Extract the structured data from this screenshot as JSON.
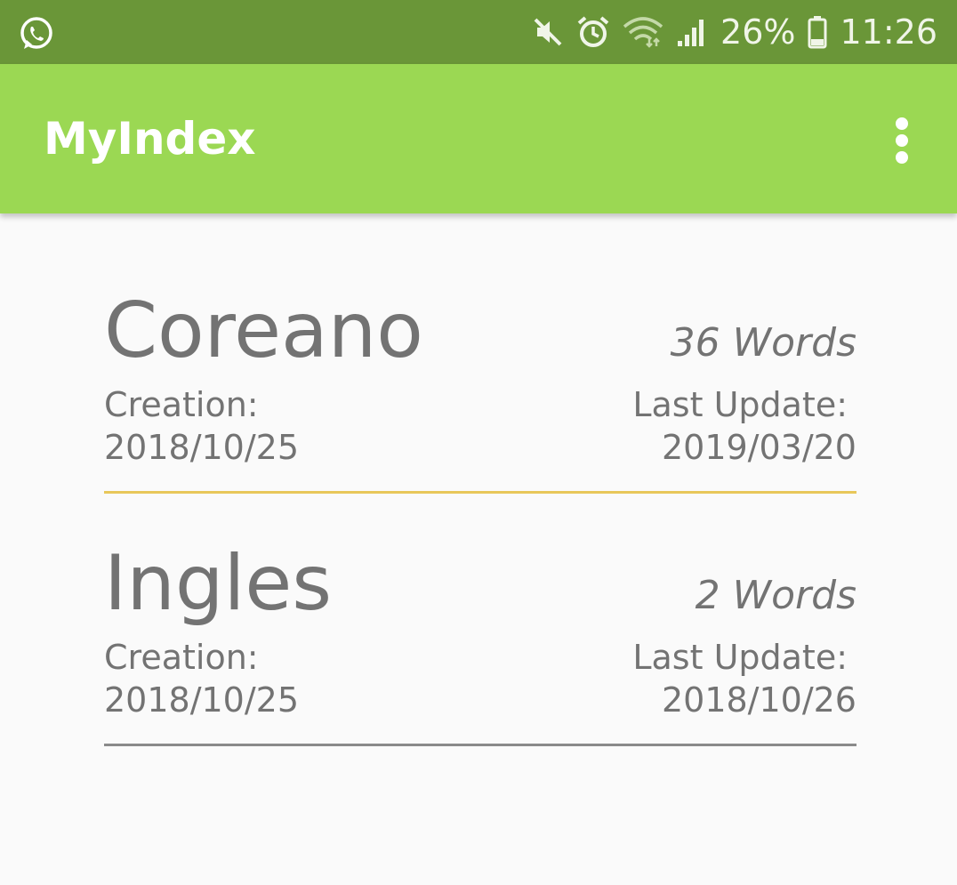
{
  "status_bar": {
    "left_icon": "whatsapp-icon",
    "icons": [
      "mute-icon",
      "alarm-icon",
      "wifi-icon",
      "signal-icon"
    ],
    "battery_percent": "26%",
    "battery_icon": "battery-icon",
    "time": "11:26"
  },
  "app_bar": {
    "title": "MyIndex",
    "menu_icon": "overflow-menu-icon",
    "background": "#9bd853",
    "status_background": "#6a9638"
  },
  "indexes": [
    {
      "name": "Coreano",
      "words": "36 Words",
      "creation_label": "Creation:",
      "creation_date": "2018/10/25",
      "update_label": "Last Update:",
      "update_date": "2019/03/20",
      "divider_color": "#e8c75a"
    },
    {
      "name": "Ingles",
      "words": "2 Words",
      "creation_label": "Creation:",
      "creation_date": "2018/10/25",
      "update_label": "Last Update:",
      "update_date": "2018/10/26",
      "divider_color": "#8a8a8a"
    }
  ]
}
